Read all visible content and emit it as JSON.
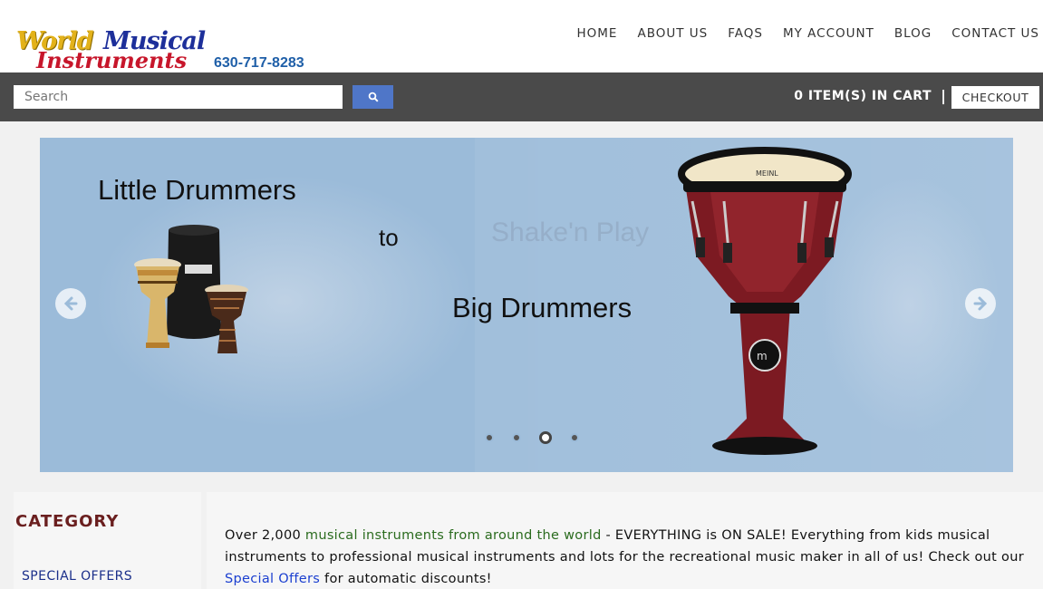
{
  "header": {
    "logo": {
      "world": "World",
      "musical": "Musical",
      "instruments": "Instruments"
    },
    "phone": "630-717-8283",
    "nav": [
      "HOME",
      "ABOUT US",
      "FAQS",
      "MY ACCOUNT",
      "BLOG",
      "CONTACT US"
    ]
  },
  "searchbar": {
    "placeholder": "Search",
    "cart_text": "0 ITEM(S) IN CART",
    "separator": "|",
    "checkout_label": "CHECKOUT"
  },
  "slider": {
    "heading_1": "Little Drummers",
    "connector": "to",
    "heading_2": "Big Drummers",
    "ghost_text": "Shake'n Play",
    "dots": 4,
    "active_dot": 3
  },
  "sidebar": {
    "title": "CATEGORY",
    "item": "SPECIAL OFFERS"
  },
  "intro": {
    "p1": "Over 2,000 ",
    "link1": "musical instruments from around the world",
    "p2": " - EVERYTHING is ON SALE! Everything from kids musical instruments to professional musical instruments and lots for the recreational music maker in all of us! Check out our ",
    "link2": "Special Offers",
    "p3": " for automatic discounts!"
  },
  "colors": {
    "bar_bg": "#4a4a4a",
    "search_btn": "#4f76c8",
    "slider_bg": "#9bbbd9",
    "category_title": "#6a1f1f",
    "link_green": "#2a6b1e",
    "link_blue": "#1b3fd0"
  },
  "icons": {
    "search": "search-icon",
    "prev": "arrow-left-icon",
    "next": "arrow-right-icon"
  }
}
